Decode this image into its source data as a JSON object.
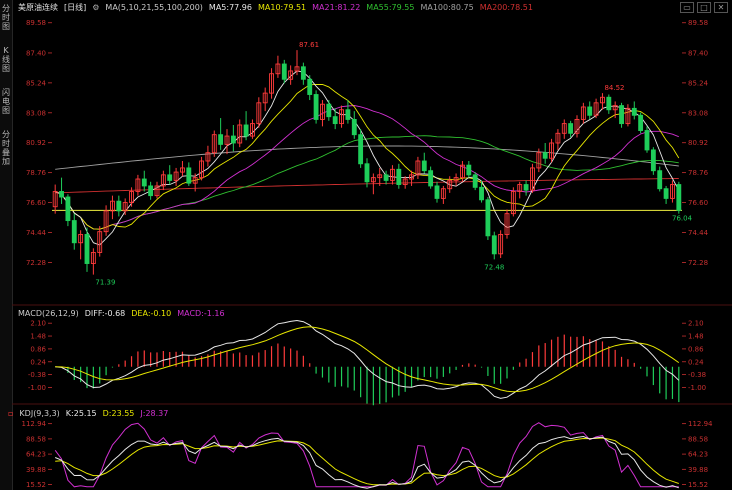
{
  "sidebar": {
    "tabs": [
      "分时图",
      "K线图",
      "闪电图",
      "分时叠加"
    ]
  },
  "main": {
    "instrument": "美原油连续",
    "period": "[日线]",
    "ma_header": {
      "params": "MA(5,10,21,55,100,200)",
      "ma5": "MA5:77.96",
      "ma10": "MA10:79.51",
      "ma21": "MA21:81.22",
      "ma55": "MA55:79.55",
      "ma100": "MA100:80.75",
      "ma200": "MA200:78.51"
    },
    "labels": {
      "high": "87.61",
      "high2": "84.52",
      "low": "71.39",
      "low2": "72.48",
      "last": "76.04"
    }
  },
  "macd": {
    "header": {
      "params": "MACD(26,12,9)",
      "diff": "DIFF:-0.68",
      "dea": "DEA:-0.10",
      "macd": "MACD:-1.16"
    }
  },
  "kdj": {
    "header": {
      "params": "KDJ(9,3,3)",
      "k": "K:25.15",
      "d": "D:23.55",
      "j": "J:28.37"
    }
  },
  "colors": {
    "up": "#ff3b3b",
    "down": "#1fce5a",
    "ma5": "#e8e8e8",
    "ma10": "#e6e600",
    "ma21": "#d030d0",
    "ma55": "#30c030",
    "ma100": "#a0a0a0",
    "ma200": "#d03030",
    "line": "#f0f040",
    "axis": "#c83030"
  },
  "chart_data": [
    {
      "type": "candlestick",
      "name": "price",
      "ylim": [
        70.0,
        90.5
      ],
      "y_ticks": [
        89.58,
        87.4,
        85.24,
        83.08,
        80.92,
        78.76,
        76.6,
        74.44,
        72.28
      ],
      "horizontal_line": 76.04,
      "candles": [
        [
          76.3,
          77.9,
          75.8,
          77.4
        ],
        [
          77.4,
          78.4,
          76.5,
          77.0
        ],
        [
          77.0,
          77.2,
          74.9,
          75.3
        ],
        [
          75.3,
          75.8,
          73.2,
          73.7
        ],
        [
          73.7,
          74.6,
          72.5,
          74.3
        ],
        [
          74.3,
          74.8,
          71.6,
          72.2
        ],
        [
          72.2,
          73.3,
          71.4,
          73.0
        ],
        [
          73.0,
          74.9,
          72.7,
          74.5
        ],
        [
          74.5,
          76.4,
          74.2,
          76.0
        ],
        [
          76.0,
          77.1,
          75.4,
          76.7
        ],
        [
          76.7,
          77.1,
          75.6,
          76.0
        ],
        [
          76.0,
          76.9,
          75.7,
          76.6
        ],
        [
          76.6,
          77.7,
          76.3,
          77.4
        ],
        [
          77.4,
          78.6,
          77.1,
          78.3
        ],
        [
          78.3,
          78.9,
          77.4,
          77.8
        ],
        [
          77.8,
          78.1,
          76.8,
          77.1
        ],
        [
          77.1,
          78.1,
          76.9,
          77.8
        ],
        [
          77.8,
          78.9,
          77.5,
          78.6
        ],
        [
          78.6,
          79.3,
          77.9,
          78.2
        ],
        [
          78.2,
          79.1,
          77.8,
          78.8
        ],
        [
          78.8,
          79.6,
          78.5,
          79.1
        ],
        [
          79.1,
          79.5,
          77.8,
          78.0
        ],
        [
          78.0,
          78.7,
          77.4,
          78.4
        ],
        [
          78.4,
          79.9,
          78.2,
          79.6
        ],
        [
          79.6,
          80.7,
          79.2,
          80.2
        ],
        [
          80.2,
          81.8,
          79.9,
          81.5
        ],
        [
          81.5,
          82.7,
          80.4,
          80.8
        ],
        [
          80.8,
          81.9,
          80.1,
          81.4
        ],
        [
          81.4,
          82.2,
          80.3,
          80.9
        ],
        [
          80.9,
          82.6,
          80.6,
          82.2
        ],
        [
          82.2,
          83.2,
          81.1,
          81.4
        ],
        [
          81.4,
          82.6,
          81.2,
          82.3
        ],
        [
          82.3,
          84.2,
          82.0,
          83.8
        ],
        [
          83.8,
          84.9,
          83.2,
          84.5
        ],
        [
          84.5,
          86.3,
          84.1,
          85.9
        ],
        [
          85.9,
          87.2,
          85.6,
          86.6
        ],
        [
          86.6,
          86.9,
          85.2,
          85.5
        ],
        [
          85.5,
          86.5,
          85.1,
          86.1
        ],
        [
          86.1,
          87.6,
          85.8,
          86.4
        ],
        [
          86.4,
          86.7,
          85.1,
          85.5
        ],
        [
          85.5,
          85.8,
          84.0,
          84.4
        ],
        [
          84.4,
          84.7,
          82.3,
          82.6
        ],
        [
          82.6,
          84.0,
          82.1,
          83.7
        ],
        [
          83.7,
          84.0,
          82.5,
          82.8
        ],
        [
          82.8,
          83.4,
          81.9,
          82.3
        ],
        [
          82.3,
          83.6,
          82.0,
          83.3
        ],
        [
          83.3,
          84.0,
          82.3,
          82.6
        ],
        [
          82.6,
          83.2,
          81.2,
          81.5
        ],
        [
          81.5,
          81.9,
          79.1,
          79.4
        ],
        [
          79.4,
          79.8,
          77.7,
          78.1
        ],
        [
          78.1,
          78.7,
          77.2,
          78.4
        ],
        [
          78.4,
          79.1,
          77.8,
          78.6
        ],
        [
          78.6,
          78.9,
          77.9,
          78.2
        ],
        [
          78.2,
          79.3,
          77.9,
          79.0
        ],
        [
          79.0,
          79.4,
          77.6,
          77.9
        ],
        [
          77.9,
          78.5,
          77.6,
          78.3
        ],
        [
          78.3,
          78.9,
          77.8,
          78.6
        ],
        [
          78.6,
          79.9,
          78.3,
          79.6
        ],
        [
          79.6,
          80.2,
          78.7,
          78.9
        ],
        [
          78.9,
          79.2,
          77.6,
          77.8
        ],
        [
          77.8,
          78.1,
          76.6,
          76.9
        ],
        [
          76.9,
          77.8,
          76.5,
          77.6
        ],
        [
          77.6,
          78.5,
          77.3,
          78.2
        ],
        [
          78.2,
          78.7,
          77.8,
          78.4
        ],
        [
          78.4,
          79.6,
          78.1,
          79.3
        ],
        [
          79.3,
          79.6,
          78.4,
          78.6
        ],
        [
          78.6,
          78.8,
          77.5,
          77.7
        ],
        [
          77.7,
          78.2,
          76.6,
          76.8
        ],
        [
          76.8,
          77.0,
          73.9,
          74.2
        ],
        [
          74.2,
          74.5,
          72.5,
          72.9
        ],
        [
          72.9,
          74.6,
          72.6,
          74.3
        ],
        [
          74.3,
          76.1,
          74.0,
          75.8
        ],
        [
          75.8,
          77.7,
          75.6,
          77.4
        ],
        [
          77.4,
          78.1,
          76.9,
          77.9
        ],
        [
          77.9,
          78.2,
          77.1,
          77.5
        ],
        [
          77.5,
          79.4,
          77.3,
          79.1
        ],
        [
          79.1,
          80.5,
          78.8,
          80.2
        ],
        [
          80.2,
          80.9,
          79.4,
          79.8
        ],
        [
          79.8,
          81.2,
          79.5,
          80.9
        ],
        [
          80.9,
          81.9,
          80.4,
          81.6
        ],
        [
          81.6,
          82.6,
          81.2,
          82.3
        ],
        [
          82.3,
          82.5,
          81.3,
          81.6
        ],
        [
          81.6,
          82.9,
          81.3,
          82.6
        ],
        [
          82.6,
          83.8,
          82.3,
          83.5
        ],
        [
          83.5,
          83.9,
          82.6,
          82.9
        ],
        [
          82.9,
          84.1,
          82.7,
          83.8
        ],
        [
          83.8,
          84.5,
          83.3,
          84.2
        ],
        [
          84.2,
          84.4,
          83.0,
          83.3
        ],
        [
          83.3,
          83.9,
          82.7,
          83.6
        ],
        [
          83.6,
          83.8,
          82.0,
          82.3
        ],
        [
          82.3,
          83.7,
          82.1,
          83.4
        ],
        [
          83.4,
          83.9,
          82.6,
          82.9
        ],
        [
          82.9,
          83.1,
          81.6,
          81.8
        ],
        [
          81.8,
          82.1,
          80.2,
          80.4
        ],
        [
          80.4,
          80.6,
          78.6,
          78.9
        ],
        [
          78.9,
          79.2,
          77.4,
          77.6
        ],
        [
          77.6,
          77.8,
          76.5,
          76.9
        ],
        [
          76.9,
          78.2,
          76.6,
          77.9
        ],
        [
          77.9,
          78.1,
          75.8,
          76.04
        ]
      ]
    },
    {
      "type": "macd",
      "name": "MACD(26,12,9)",
      "ylim": [
        -1.7,
        2.35
      ],
      "y_ticks": [
        2.1,
        1.48,
        0.86,
        0.24,
        -0.38,
        -1.0
      ]
    },
    {
      "type": "kdj",
      "name": "KDJ(9,3,3)",
      "ylim": [
        10,
        122
      ],
      "y_ticks": [
        112.94,
        88.58,
        64.23,
        39.88,
        15.52
      ]
    }
  ]
}
